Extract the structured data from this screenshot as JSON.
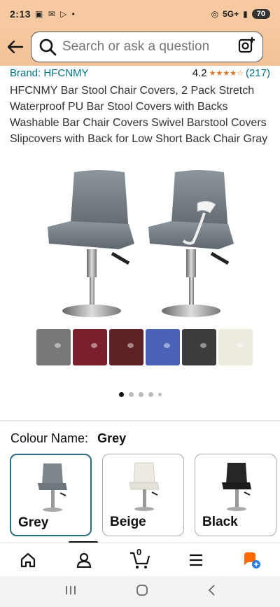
{
  "status_bar": {
    "time": "2:13",
    "network": "5G+",
    "battery": "70"
  },
  "header": {
    "search_placeholder": "Search or ask a question"
  },
  "product": {
    "brand": "Brand: HFCNMY",
    "rating": "4.2",
    "stars": 4.2,
    "review_count": "(217)",
    "title": "HFCNMY Bar Stool Chair Covers, 2 Pack Stretch Waterproof PU Bar Stool Covers with Backs Washable Bar Chair Covers Swivel Barstool Covers Slipcovers with Back for Low Short Back Chair Gray"
  },
  "gallery": {
    "swatch_colors": [
      "#77787a",
      "#7a1f2e",
      "#5e2226",
      "#4a63b8",
      "#3c3c3c",
      "#eeeae0"
    ],
    "image_count": 5,
    "active_index": 0
  },
  "colour": {
    "label": "Colour Name:",
    "value": "Grey",
    "options": [
      {
        "label": "Grey",
        "color": "#7f868c",
        "selected": true
      },
      {
        "label": "Beige",
        "color": "#efebe2",
        "selected": false
      },
      {
        "label": "Black",
        "color": "#262626",
        "selected": false
      }
    ]
  },
  "bottom_nav": {
    "items": [
      "home-icon",
      "account-icon",
      "cart-icon",
      "menu-icon",
      "ai-assistant-icon"
    ],
    "cart_count": "0"
  },
  "accent_color": "#007185"
}
